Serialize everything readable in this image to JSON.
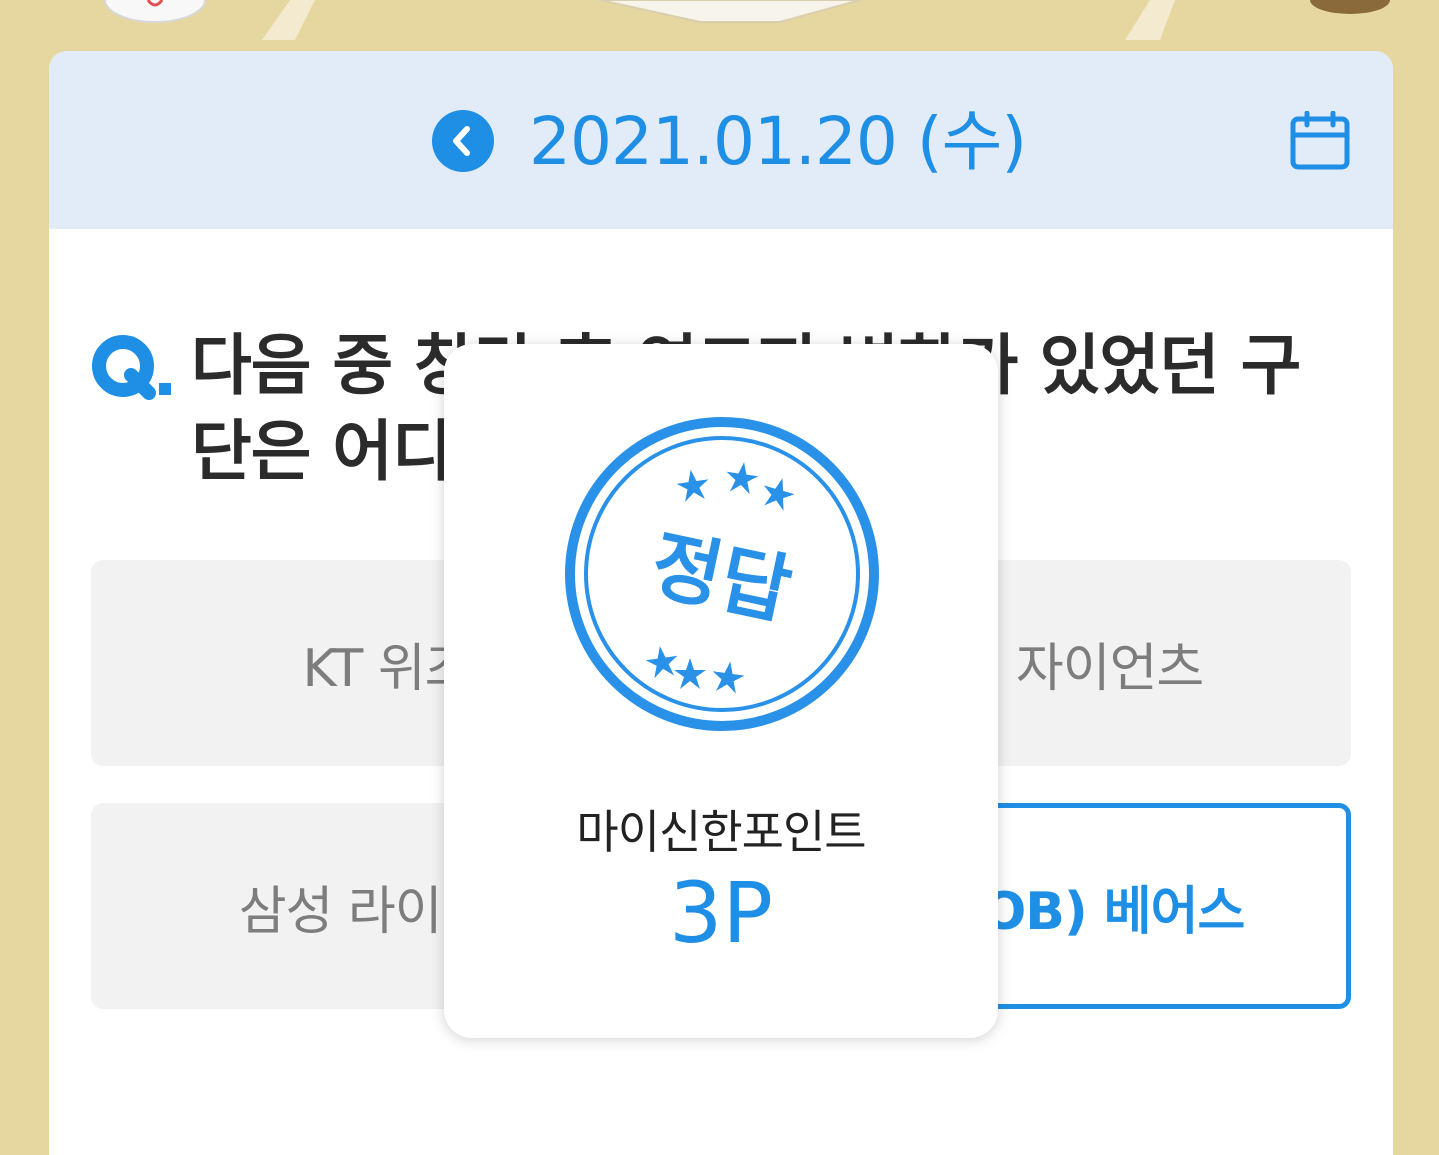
{
  "header": {
    "date": "2021.01.20 (수)",
    "prev_icon": "chevron-left-icon",
    "calendar_icon": "calendar-icon"
  },
  "quiz": {
    "q_mark": "Q.",
    "question": "다음 중 창단 후 연고지 변화가 있었던 구단은 어디일까요?",
    "options": [
      "KT 위즈",
      "롯데 자이언츠",
      "삼성 라이온즈",
      "두산(OB) 베어스"
    ],
    "selected_index": 3
  },
  "popup": {
    "stamp_text": "정답",
    "reward_label": "마이신한포인트",
    "reward_value": "3P"
  },
  "colors": {
    "accent": "#1f8fe6",
    "background": "#e6d7a0",
    "date_bar": "#e1ecf8"
  }
}
